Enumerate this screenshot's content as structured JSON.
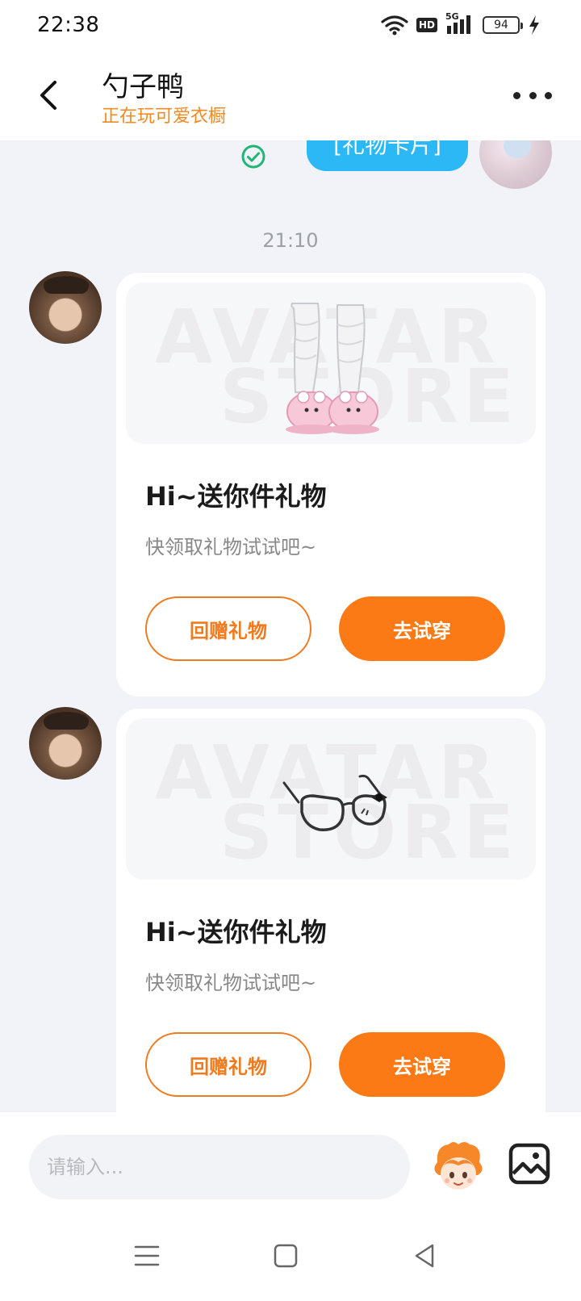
{
  "status_bar": {
    "time": "22:38",
    "hd": "HD",
    "network": "5G",
    "battery": "94"
  },
  "header": {
    "title": "勺子鸭",
    "subtitle": "正在玩可爱衣橱"
  },
  "chat": {
    "previous_bubble": "[礼物卡片]",
    "timestamp": "21:10",
    "watermark_line1": "AVATAR",
    "watermark_line2": "STORE",
    "cards": [
      {
        "gift": "socks-with-bunny-slippers",
        "title": "Hi~送你件礼物",
        "desc": "快领取礼物试试吧~",
        "btn_return": "回赠礼物",
        "btn_try": "去试穿"
      },
      {
        "gift": "glasses-with-bow",
        "title": "Hi~送你件礼物",
        "desc": "快领取礼物试试吧~",
        "btn_return": "回赠礼物",
        "btn_try": "去试穿"
      }
    ]
  },
  "input_bar": {
    "placeholder": "请输入..."
  },
  "colors": {
    "accent_orange": "#fb7a15",
    "subtitle_orange": "#f08a24",
    "bubble_blue": "#2bb8f4",
    "sent_check_green": "#22b573"
  }
}
